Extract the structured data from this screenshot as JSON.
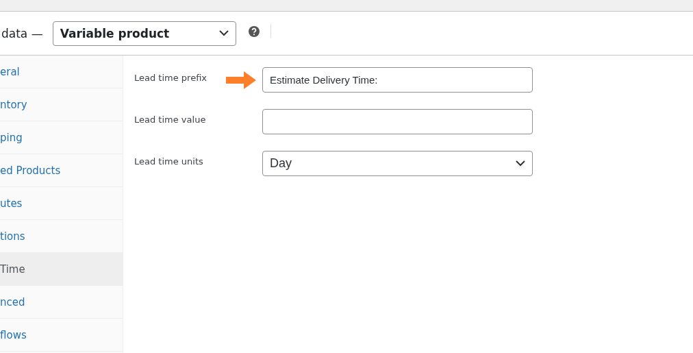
{
  "header": {
    "label": "data —",
    "product_type": "Variable product"
  },
  "tabs": [
    {
      "label": "eral",
      "selected": false
    },
    {
      "label": "ntory",
      "selected": false
    },
    {
      "label": "ping",
      "selected": false
    },
    {
      "label": "ed Products",
      "selected": false
    },
    {
      "label": "utes",
      "selected": false
    },
    {
      "label": "tions",
      "selected": false
    },
    {
      "label": "Time",
      "selected": true
    },
    {
      "label": "nced",
      "selected": false
    },
    {
      "label": "flows",
      "selected": false
    }
  ],
  "fields": [
    {
      "kind": "text",
      "label": "Lead time prefix",
      "value": "Estimate Delivery Time:",
      "highlighted": true
    },
    {
      "kind": "text",
      "label": "Lead time value",
      "highlighted": false
    },
    {
      "kind": "select",
      "label": "Lead time units",
      "value": "Day",
      "highlighted": false
    }
  ]
}
